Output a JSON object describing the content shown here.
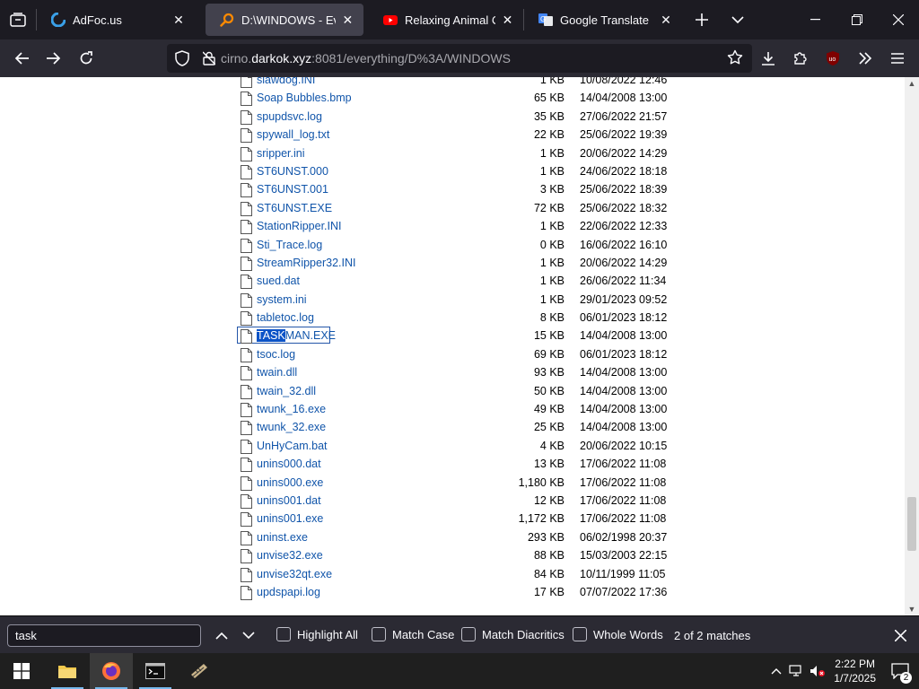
{
  "tabs": [
    {
      "title": "AdFoc.us",
      "favicon": "adfocus-favicon",
      "active": false
    },
    {
      "title": "D:\\WINDOWS - Everyth",
      "favicon": "everything-favicon",
      "active": true
    },
    {
      "title": "Relaxing Animal Crossi",
      "favicon": "youtube-favicon",
      "active": false
    },
    {
      "title": "Google Translate",
      "favicon": "google-translate-favicon",
      "active": false
    }
  ],
  "urlbar": {
    "prefix": "cirno.",
    "domain": "darkok.xyz",
    "suffix": ":8081/everything/D%3A/WINDOWS"
  },
  "files": [
    {
      "name": "slawdog.INI",
      "size": "1 KB",
      "date": "10/08/2022 12:46"
    },
    {
      "name": "Soap Bubbles.bmp",
      "size": "65 KB",
      "date": "14/04/2008 13:00"
    },
    {
      "name": "spupdsvc.log",
      "size": "35 KB",
      "date": "27/06/2022 21:57"
    },
    {
      "name": "spywall_log.txt",
      "size": "22 KB",
      "date": "25/06/2022 19:39"
    },
    {
      "name": "sripper.ini",
      "size": "1 KB",
      "date": "20/06/2022 14:29"
    },
    {
      "name": "ST6UNST.000",
      "size": "1 KB",
      "date": "24/06/2022 18:18"
    },
    {
      "name": "ST6UNST.001",
      "size": "3 KB",
      "date": "25/06/2022 18:39"
    },
    {
      "name": "ST6UNST.EXE",
      "size": "72 KB",
      "date": "25/06/2022 18:32"
    },
    {
      "name": "StationRipper.INI",
      "size": "1 KB",
      "date": "22/06/2022 12:33"
    },
    {
      "name": "Sti_Trace.log",
      "size": "0 KB",
      "date": "16/06/2022 16:10"
    },
    {
      "name": "StreamRipper32.INI",
      "size": "1 KB",
      "date": "20/06/2022 14:29"
    },
    {
      "name": "sued.dat",
      "size": "1 KB",
      "date": "26/06/2022 11:34"
    },
    {
      "name": "system.ini",
      "size": "1 KB",
      "date": "29/01/2023 09:52"
    },
    {
      "name": "tabletoc.log",
      "size": "8 KB",
      "date": "06/01/2023 18:12"
    },
    {
      "name": "TASKMAN.EXE",
      "name_highlight": "TASK",
      "name_rest": "MAN.EXE",
      "size": "15 KB",
      "date": "14/04/2008 13:00",
      "selected": true
    },
    {
      "name": "tsoc.log",
      "size": "69 KB",
      "date": "06/01/2023 18:12"
    },
    {
      "name": "twain.dll",
      "size": "93 KB",
      "date": "14/04/2008 13:00"
    },
    {
      "name": "twain_32.dll",
      "size": "50 KB",
      "date": "14/04/2008 13:00"
    },
    {
      "name": "twunk_16.exe",
      "size": "49 KB",
      "date": "14/04/2008 13:00"
    },
    {
      "name": "twunk_32.exe",
      "size": "25 KB",
      "date": "14/04/2008 13:00"
    },
    {
      "name": "UnHyCam.bat",
      "size": "4 KB",
      "date": "20/06/2022 10:15"
    },
    {
      "name": "unins000.dat",
      "size": "13 KB",
      "date": "17/06/2022 11:08"
    },
    {
      "name": "unins000.exe",
      "size": "1,180 KB",
      "date": "17/06/2022 11:08"
    },
    {
      "name": "unins001.dat",
      "size": "12 KB",
      "date": "17/06/2022 11:08"
    },
    {
      "name": "unins001.exe",
      "size": "1,172 KB",
      "date": "17/06/2022 11:08"
    },
    {
      "name": "uninst.exe",
      "size": "293 KB",
      "date": "06/02/1998 20:37"
    },
    {
      "name": "unvise32.exe",
      "size": "88 KB",
      "date": "15/03/2003 22:15"
    },
    {
      "name": "unvise32qt.exe",
      "size": "84 KB",
      "date": "10/11/1999 11:05"
    },
    {
      "name": "updspapi.log",
      "size": "17 KB",
      "date": "07/07/2022 17:36"
    }
  ],
  "findbar": {
    "query": "task",
    "highlight_all": "Highlight All",
    "match_case": "Match Case",
    "match_diacritics": "Match Diacritics",
    "whole_words": "Whole Words",
    "status": "2 of 2 matches"
  },
  "taskbar": {
    "time": "2:22 PM",
    "date": "1/7/2025",
    "notification_count": "2"
  },
  "colors": {
    "tabstrip": "#1c1b22",
    "toolbar": "#2b2a33",
    "link": "#1155aa",
    "highlight": "#0b53c7"
  }
}
